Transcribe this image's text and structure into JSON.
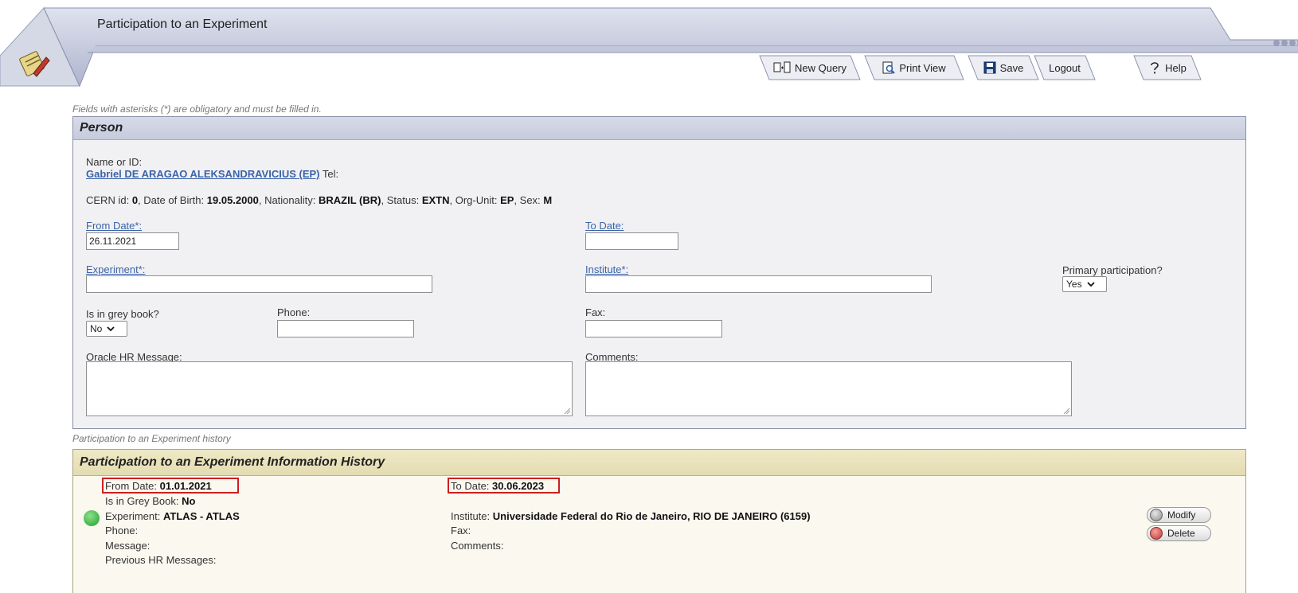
{
  "header": {
    "app_title": "Participation to an Experiment",
    "toolbar": {
      "new_query": "New Query",
      "print_view": "Print View",
      "save": "Save",
      "logout": "Logout",
      "help": "Help"
    }
  },
  "obligatory_note": "Fields with asterisks (*) are obligatory and must be filled in.",
  "person": {
    "panel_title": "Person",
    "name_label": "Name or ID:",
    "person_name": "Gabriel DE ARAGAO ALEKSANDRAVICIUS (EP)",
    "tel_label": "Tel:",
    "info": {
      "cern_id_label": "CERN id:",
      "cern_id": "0",
      "dob_label": ", Date of Birth:",
      "dob": "19.05.2000",
      "nationality_label": ", Nationality:",
      "nationality": "BRAZIL (BR)",
      "status_label": ", Status:",
      "status": "EXTN",
      "org_unit_label": ", Org-Unit:",
      "org_unit": "EP",
      "sex_label": ", Sex:",
      "sex": "M"
    },
    "from_date_label": "From Date*:",
    "from_date_value": "26.11.2021",
    "to_date_label": "To Date:",
    "to_date_value": "",
    "experiment_label": "Experiment*:",
    "experiment_value": "",
    "institute_label": "Institute*:",
    "institute_value": "",
    "primary_label": "Primary participation?",
    "primary_value": "Yes",
    "grey_book_label": "Is in grey book?",
    "grey_book_value": "No",
    "phone_label": "Phone:",
    "phone_value": "",
    "fax_label": "Fax:",
    "fax_value": "",
    "oracle_hr_label": "Oracle HR Message:",
    "comments_label": "Comments:"
  },
  "history_note": "Participation to an Experiment history",
  "history": {
    "panel_title": "Participation to an Experiment Information History",
    "from_date_label": "From Date:",
    "from_date": "01.01.2021",
    "to_date_label": "To Date:",
    "to_date": "30.06.2023",
    "grey_book_label": "Is in Grey Book:",
    "grey_book": "No",
    "experiment_label": "Experiment:",
    "experiment": "ATLAS - ATLAS",
    "institute_label": "Institute:",
    "institute": "Universidade Federal do Rio de Janeiro, RIO DE JANEIRO (6159)",
    "phone_label": "Phone:",
    "fax_label": "Fax:",
    "message_label": "Message:",
    "comments_label": "Comments:",
    "previous_hr_label": "Previous HR Messages:",
    "modify_label": "Modify",
    "delete_label": "Delete"
  },
  "colors": {
    "header_band": "#b9bfd6",
    "person_panel_bg": "#f1f1f4",
    "history_panel_bg": "#faf8ef",
    "highlight": "#cc1f1f",
    "link": "#3a63a8"
  }
}
